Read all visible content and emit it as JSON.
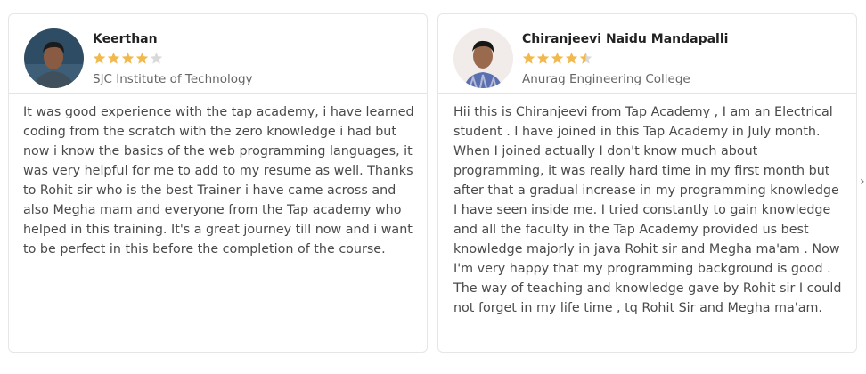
{
  "reviews": [
    {
      "name": "Keerthan",
      "rating": 4,
      "organization": "SJC Institute of Technology",
      "text": "It was good experience with the tap academy, i have learned coding from the scratch with the zero knowledge i had but now i know the basics of the web programming languages, it was very helpful for me to add to my resume as well. Thanks to Rohit sir who is the best Trainer i have came across and also Megha mam and everyone from the Tap academy who helped in this training. It's a great journey till now and i want to be perfect in this before the completion of the course."
    },
    {
      "name": "Chiranjeevi Naidu Mandapalli",
      "rating": 4.5,
      "organization": "Anurag Engineering College",
      "text": "Hii this is Chiranjeevi from Tap Academy , I am an Electrical student . I have joined in this Tap Academy in July month. When I joined actually I don't know much about programming, it was really hard time in my first month but after that a gradual increase in my programming knowledge I have seen inside me. I tried constantly to gain knowledge and all the faculty in the Tap Academy provided us best knowledge majorly in java Rohit sir and Megha ma'am . Now I'm very happy that my programming background is good . The way of teaching and knowledge gave by Rohit sir I could not forget in my life time , tq Rohit Sir and Megha ma'am."
    }
  ],
  "colors": {
    "star_filled": "#f2b84b",
    "star_empty": "#d9d9d9"
  },
  "icons": {
    "next": "chevron-right-icon"
  }
}
